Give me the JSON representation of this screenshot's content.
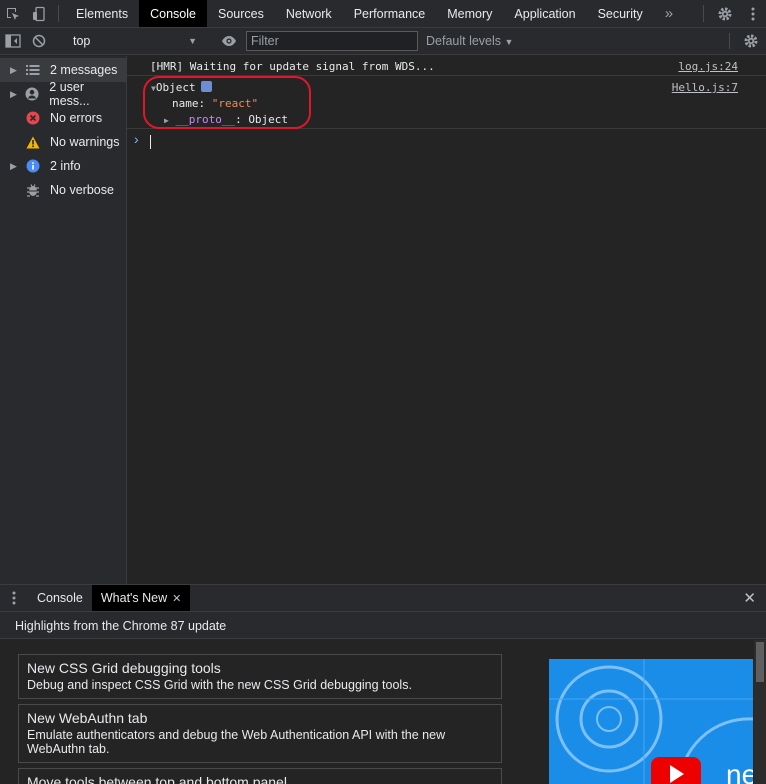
{
  "tabbar": {
    "tabs": [
      "Elements",
      "Console",
      "Sources",
      "Network",
      "Performance",
      "Memory",
      "Application",
      "Security"
    ],
    "overflow": "»"
  },
  "toolbar": {
    "context": "top",
    "filter_placeholder": "Filter",
    "levels": "Default levels"
  },
  "sidebar": {
    "items": [
      {
        "label": "2 messages",
        "icon": "list-icon",
        "expandable": true
      },
      {
        "label": "2 user mess...",
        "icon": "user-icon",
        "expandable": true
      },
      {
        "label": "No errors",
        "icon": "error-icon",
        "expandable": false
      },
      {
        "label": "No warnings",
        "icon": "warning-icon",
        "expandable": false
      },
      {
        "label": "2 info",
        "icon": "info-icon",
        "expandable": true
      },
      {
        "label": "No verbose",
        "icon": "bug-icon",
        "expandable": false
      }
    ]
  },
  "console": {
    "messages": [
      {
        "text": "[HMR] Waiting for update signal from WDS...",
        "source": "log.js:24"
      },
      {
        "object_label": "Object",
        "source": "Hello.js:7",
        "prop_key": "name",
        "prop_value": "\"react\"",
        "proto_key": "__proto__",
        "proto_value": "Object"
      }
    ],
    "prompt": "›"
  },
  "drawer": {
    "tabs": [
      "Console",
      "What's New"
    ],
    "header": "Highlights from the Chrome 87 update",
    "cards": [
      {
        "title": "New CSS Grid debugging tools",
        "desc": "Debug and inspect CSS Grid with the new CSS Grid debugging tools."
      },
      {
        "title": "New WebAuthn tab",
        "desc": "Emulate authenticators and debug the Web Authentication API with the new WebAuthn tab."
      },
      {
        "title": "Move tools between top and bottom panel",
        "desc": ""
      }
    ],
    "video_text": "ne"
  },
  "colors": {
    "accent": "#8ab4f8",
    "error": "#e0172b",
    "string": "#f28b54",
    "video_bg": "#1a8de8"
  }
}
